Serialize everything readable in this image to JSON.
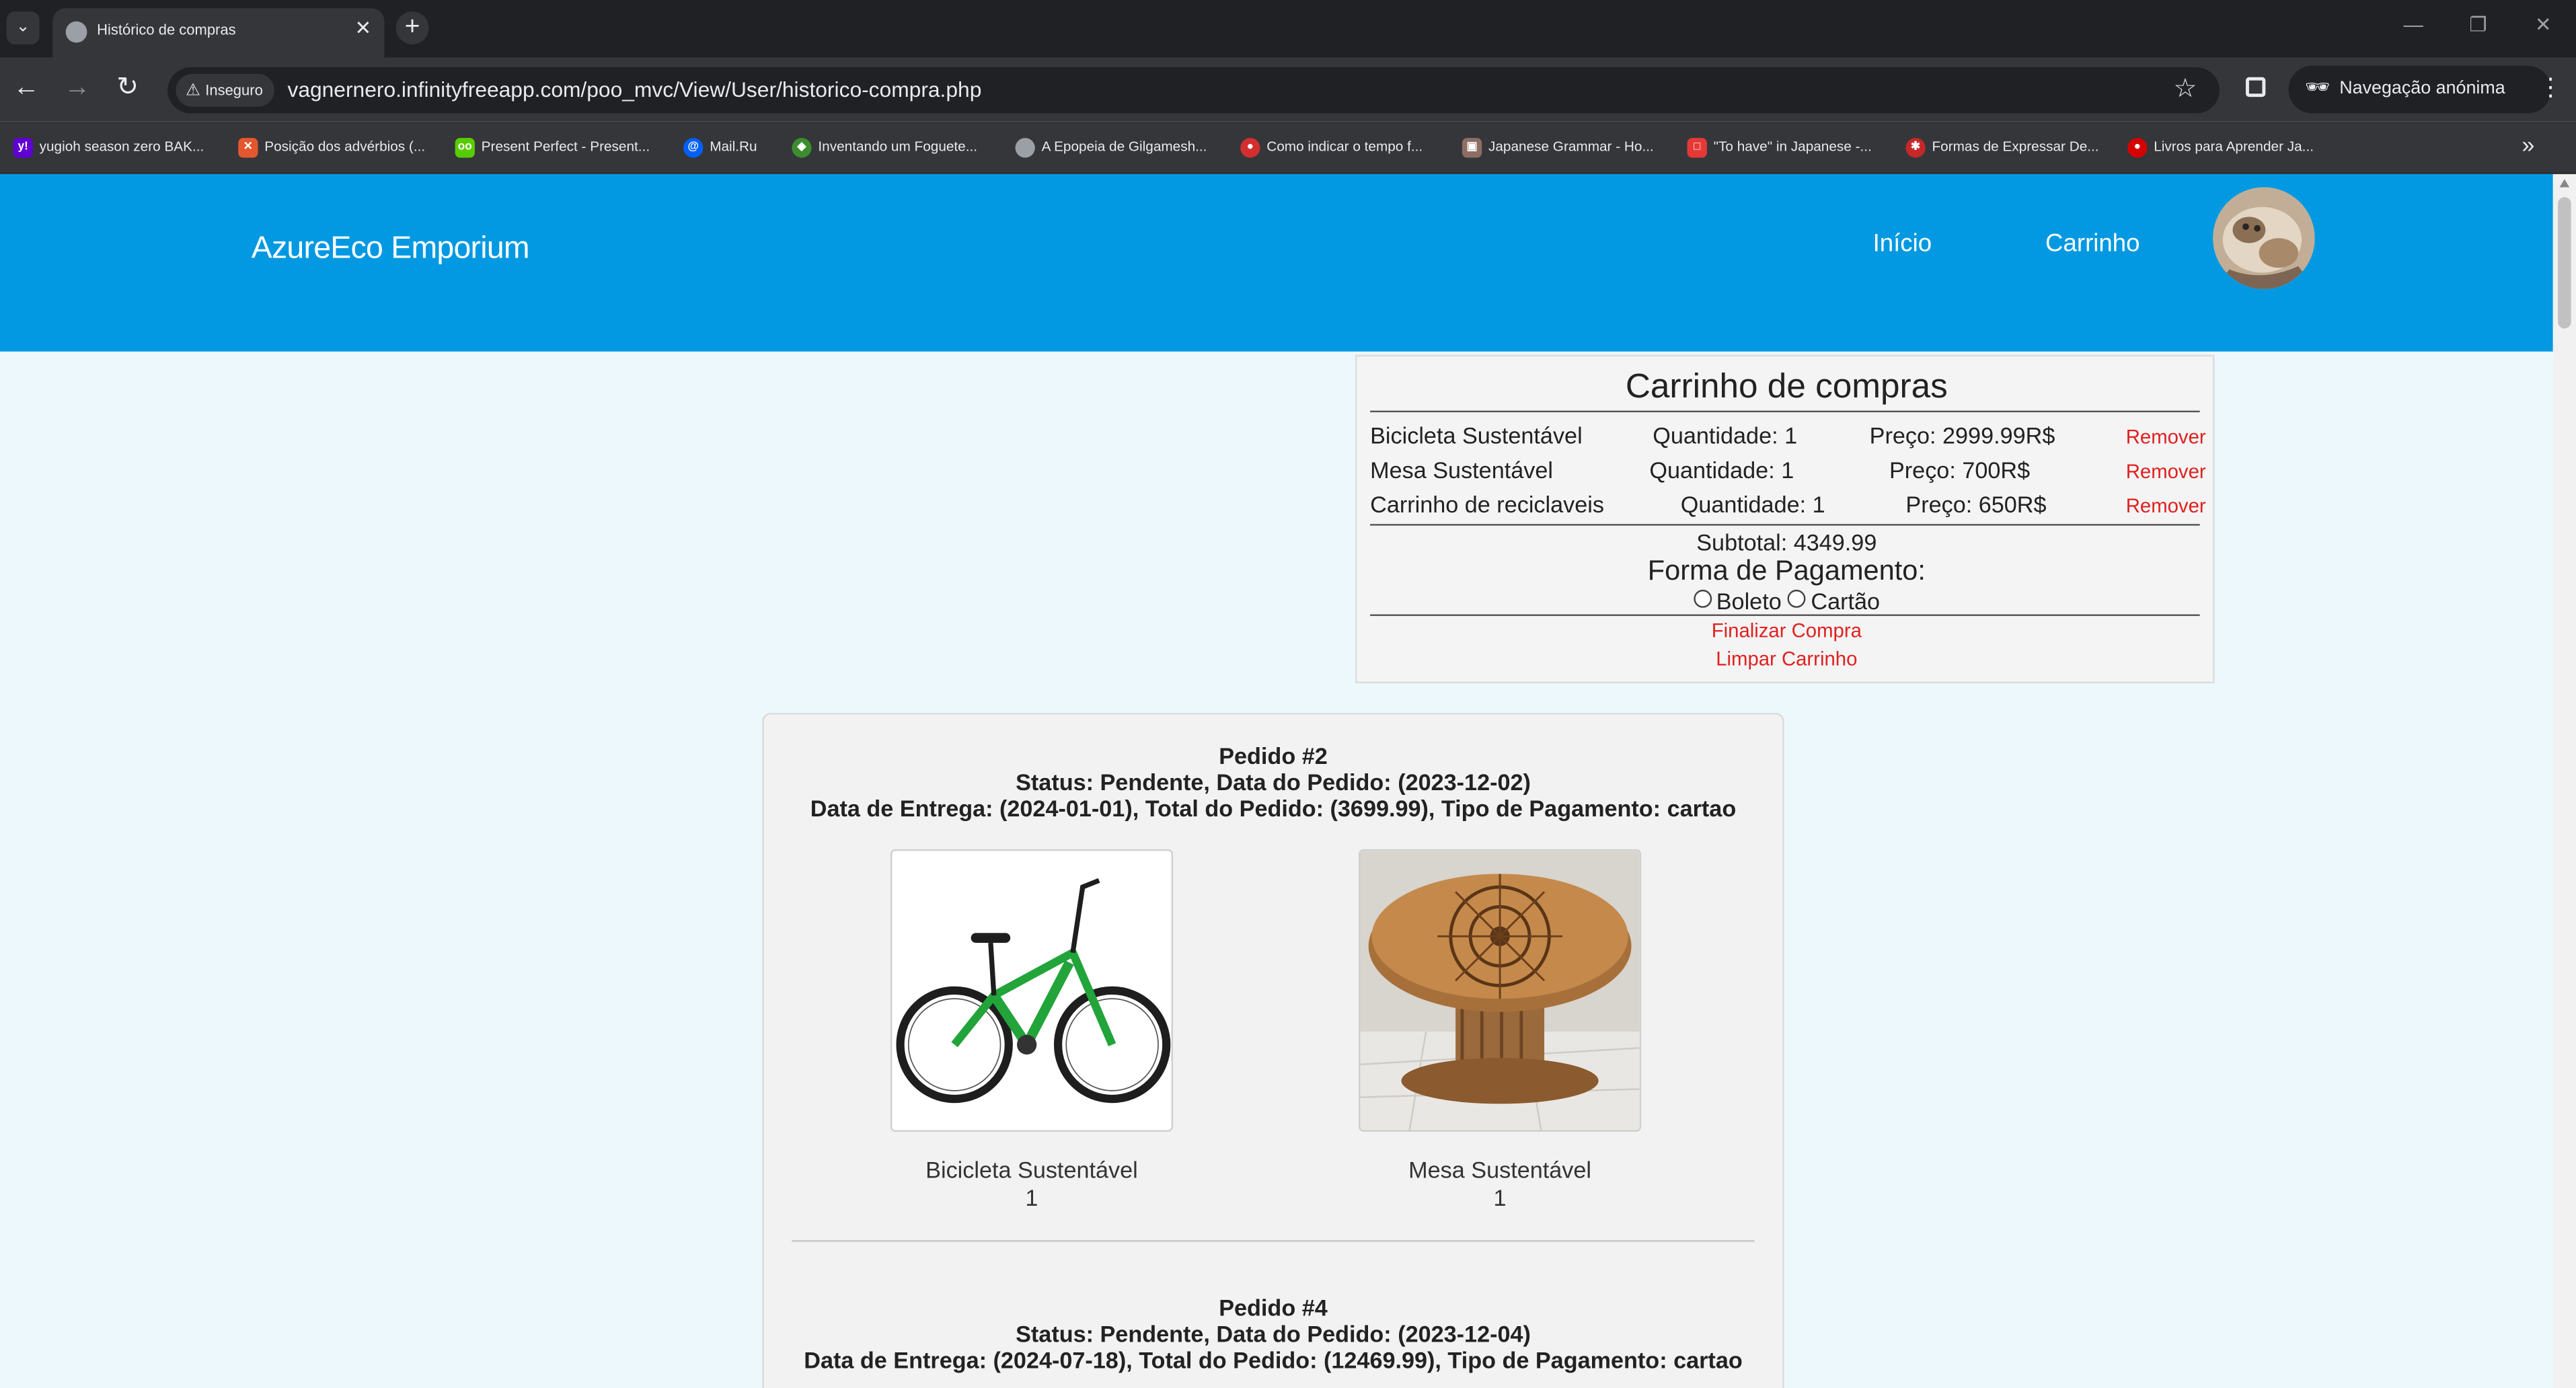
{
  "browser": {
    "tab_title": "Histórico de compras",
    "tab_close": "✕",
    "new_tab": "+",
    "security_label": "Inseguro",
    "url": "vagnernero.infinityfreeapp.com/poo_mvc/View/User/historico-compra.php",
    "incognito_label": "Navegação anónima",
    "bookmarks": [
      {
        "label": "yugioh season zero BAK...",
        "color": "#6001d2"
      },
      {
        "label": "Posição dos advérbios (...",
        "color": "#e4572e"
      },
      {
        "label": "Present Perfect - Present...",
        "color": "#58cc02"
      },
      {
        "label": "Mail.Ru",
        "color": "#005ff9"
      },
      {
        "label": "Inventando um Foguete...",
        "color": "#3c8d2f"
      },
      {
        "label": "A Epopeia de Gilgamesh...",
        "color": "#9aa0a6"
      },
      {
        "label": "Como indicar o tempo f...",
        "color": "#d32f2f"
      },
      {
        "label": "Japanese Grammar - Ho...",
        "color": "#8d6e63"
      },
      {
        "label": "\"To have\" in Japanese -...",
        "color": "#e53935"
      },
      {
        "label": "Formas de Expressar De...",
        "color": "#c62828"
      },
      {
        "label": "Livros para Aprender Ja...",
        "color": "#d50000"
      }
    ]
  },
  "header": {
    "brand": "AzureEco Emporium",
    "nav": {
      "home": "Início",
      "cart": "Carrinho"
    },
    "accent_color": "#0299e2"
  },
  "cart": {
    "title": "Carrinho de compras",
    "items": [
      {
        "name": "Bicicleta Sustentável",
        "quantity": "Quantidade: 1",
        "price": "Preço: 2999.99R$",
        "remove": "Remover"
      },
      {
        "name": "Mesa Sustentável",
        "quantity": "Quantidade: 1",
        "price": "Preço: 700R$",
        "remove": "Remover"
      },
      {
        "name": "Carrinho de reciclaveis",
        "quantity": "Quantidade: 1",
        "price": "Preço: 650R$",
        "remove": "Remover"
      }
    ],
    "subtotal": "Subtotal: 4349.99",
    "payment_title": "Forma de Pagamento:",
    "payment_options": [
      "Boleto",
      "Cartão"
    ],
    "finalize": "Finalizar Compra",
    "clear": "Limpar Carrinho"
  },
  "orders": [
    {
      "title": "Pedido #2",
      "status": "Status: Pendente, Data do Pedido: (2023-12-02)",
      "details": "Data de Entrega: (2024-01-01), Total do Pedido: (3699.99), Tipo de Pagamento: cartao",
      "products": [
        {
          "name": "Bicicleta Sustentável",
          "quantity": "1"
        },
        {
          "name": "Mesa Sustentável",
          "quantity": "1"
        }
      ]
    },
    {
      "title": "Pedido #4",
      "status": "Status: Pendente, Data do Pedido: (2023-12-04)",
      "details": "Data de Entrega: (2024-07-18), Total do Pedido: (12469.99), Tipo de Pagamento: cartao"
    }
  ]
}
